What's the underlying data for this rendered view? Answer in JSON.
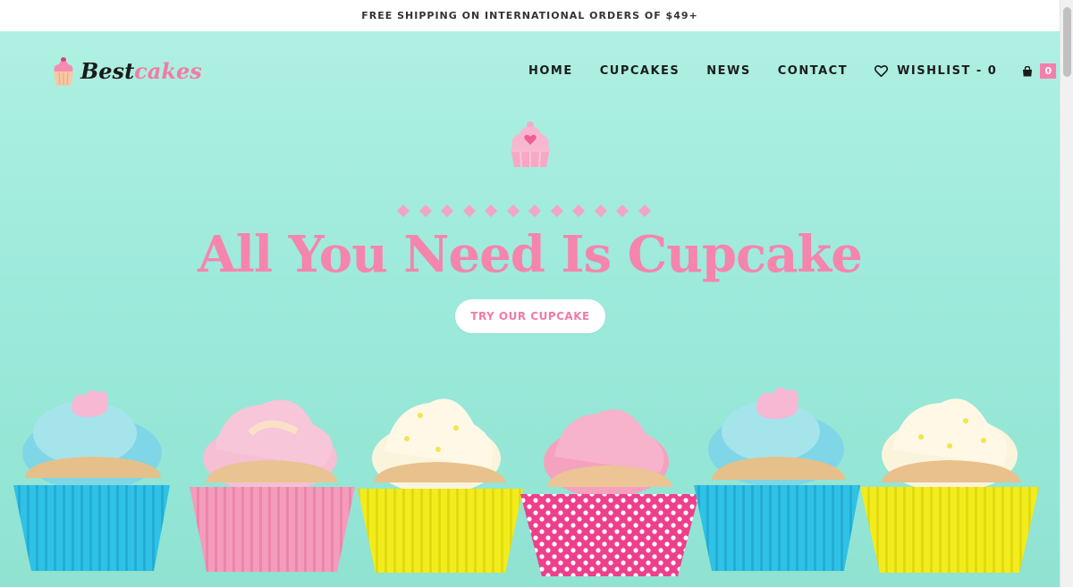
{
  "announcement": "FREE SHIPPING ON INTERNATIONAL ORDERS OF $49+",
  "logo": {
    "part1": "Best",
    "part2": "cakes"
  },
  "nav": {
    "items": [
      "HOME",
      "CUPCAKES",
      "NEWS",
      "CONTACT"
    ],
    "wishlist": "WISHLIST - 0",
    "cart_count": "0"
  },
  "hero": {
    "headline": "All You Need Is Cupcake",
    "cta": "TRY OUR CUPCAKE"
  },
  "icons": {
    "wishlist": "heart-outline-icon",
    "cart": "shopping-bag-icon",
    "logo": "cupcake-logo-icon",
    "hero": "cupcake-heart-icon"
  },
  "colors": {
    "brand_pink": "#f27ba6",
    "hero_background": "#9deadb",
    "headline": "#f585ad"
  }
}
